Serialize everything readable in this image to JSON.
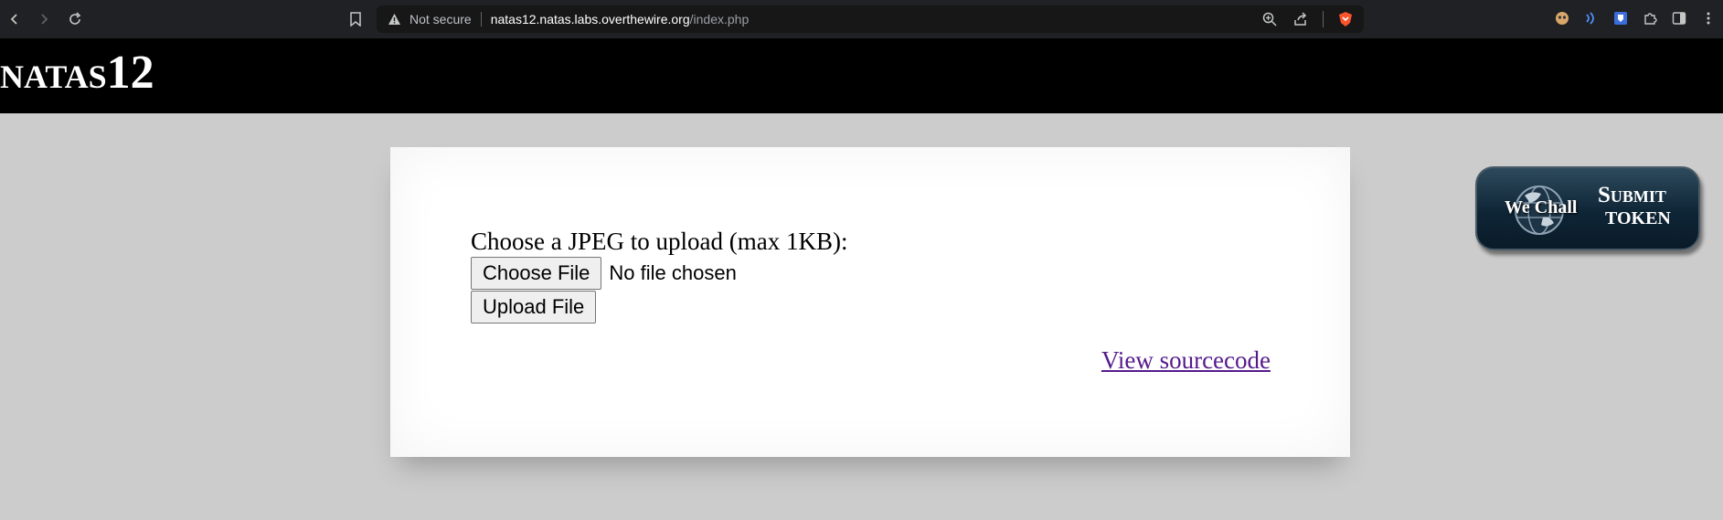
{
  "browser": {
    "security_label": "Not secure",
    "url_host": "natas12.natas.labs.overthewire.org",
    "url_path": "/index.php"
  },
  "header": {
    "title": "natas12"
  },
  "form": {
    "label": "Choose a JPEG to upload (max 1KB):",
    "choose_button": "Choose File",
    "file_status": "No file chosen",
    "upload_button": "Upload File"
  },
  "view_source_link": "View sourcecode",
  "wechall": {
    "brand": "We Chall",
    "submit": "Submit",
    "token": "TOKEN"
  },
  "colors": {
    "page_bg": "#cccccc",
    "header_bg": "#000000",
    "link_visited": "#551a8b"
  }
}
